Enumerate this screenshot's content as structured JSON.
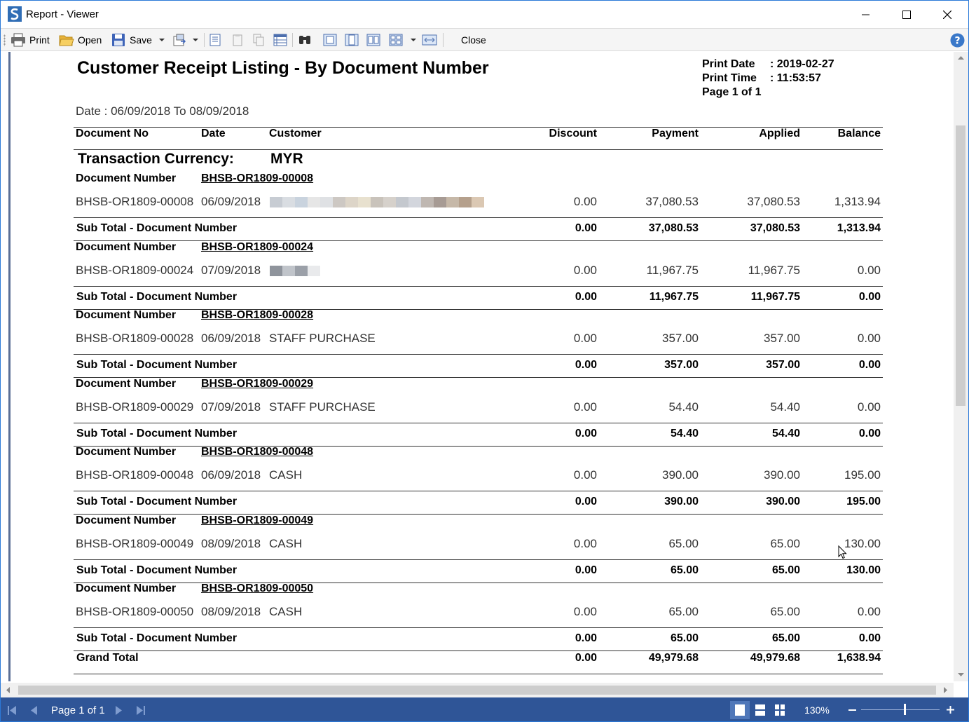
{
  "window": {
    "title": "Report - Viewer"
  },
  "toolbar": {
    "print_label": "Print",
    "open_label": "Open",
    "save_label": "Save",
    "close_label": "Close"
  },
  "report": {
    "title": "Customer Receipt Listing - By Document Number",
    "print_date_label": "Print Date",
    "print_date": ": 2019-02-27",
    "print_time_label": "Print Time",
    "print_time": ": 11:53:57",
    "page_info": "Page 1 of 1",
    "date_range": "Date : 06/09/2018 To 08/09/2018",
    "columns": {
      "document_no": "Document No",
      "date": "Date",
      "customer": "Customer",
      "discount": "Discount",
      "payment": "Payment",
      "applied": "Applied",
      "balance": "Balance"
    },
    "currency_label": "Transaction Currency:",
    "currency": "MYR",
    "group_label": "Document Number",
    "subtotal_label": "Sub Total - Document Number",
    "groups": [
      {
        "doc": "BHSB-OR1809-00008",
        "row": {
          "doc": "BHSB-OR1809-00008",
          "date": "06/09/2018",
          "customer": "",
          "discount": "0.00",
          "payment": "37,080.53",
          "applied": "37,080.53",
          "balance": "1,313.94"
        },
        "subtotal": {
          "discount": "0.00",
          "payment": "37,080.53",
          "applied": "37,080.53",
          "balance": "1,313.94"
        }
      },
      {
        "doc": "BHSB-OR1809-00024",
        "row": {
          "doc": "BHSB-OR1809-00024",
          "date": "07/09/2018",
          "customer": "",
          "discount": "0.00",
          "payment": "11,967.75",
          "applied": "11,967.75",
          "balance": "0.00"
        },
        "subtotal": {
          "discount": "0.00",
          "payment": "11,967.75",
          "applied": "11,967.75",
          "balance": "0.00"
        }
      },
      {
        "doc": "BHSB-OR1809-00028",
        "row": {
          "doc": "BHSB-OR1809-00028",
          "date": "06/09/2018",
          "customer": "STAFF PURCHASE",
          "discount": "0.00",
          "payment": "357.00",
          "applied": "357.00",
          "balance": "0.00"
        },
        "subtotal": {
          "discount": "0.00",
          "payment": "357.00",
          "applied": "357.00",
          "balance": "0.00"
        }
      },
      {
        "doc": "BHSB-OR1809-00029",
        "row": {
          "doc": "BHSB-OR1809-00029",
          "date": "07/09/2018",
          "customer": "STAFF PURCHASE",
          "discount": "0.00",
          "payment": "54.40",
          "applied": "54.40",
          "balance": "0.00"
        },
        "subtotal": {
          "discount": "0.00",
          "payment": "54.40",
          "applied": "54.40",
          "balance": "0.00"
        }
      },
      {
        "doc": "BHSB-OR1809-00048",
        "row": {
          "doc": "BHSB-OR1809-00048",
          "date": "06/09/2018",
          "customer": "CASH",
          "discount": "0.00",
          "payment": "390.00",
          "applied": "390.00",
          "balance": "195.00"
        },
        "subtotal": {
          "discount": "0.00",
          "payment": "390.00",
          "applied": "390.00",
          "balance": "195.00"
        }
      },
      {
        "doc": "BHSB-OR1809-00049",
        "row": {
          "doc": "BHSB-OR1809-00049",
          "date": "08/09/2018",
          "customer": "CASH",
          "discount": "0.00",
          "payment": "65.00",
          "applied": "65.00",
          "balance": "130.00"
        },
        "subtotal": {
          "discount": "0.00",
          "payment": "65.00",
          "applied": "65.00",
          "balance": "130.00"
        }
      },
      {
        "doc": "BHSB-OR1809-00050",
        "row": {
          "doc": "BHSB-OR1809-00050",
          "date": "08/09/2018",
          "customer": "CASH",
          "discount": "0.00",
          "payment": "65.00",
          "applied": "65.00",
          "balance": "0.00"
        },
        "subtotal": {
          "discount": "0.00",
          "payment": "65.00",
          "applied": "65.00",
          "balance": "0.00"
        }
      }
    ],
    "grand_total_label": "Grand Total",
    "grand_total": {
      "discount": "0.00",
      "payment": "49,979.68",
      "applied": "49,979.68",
      "balance": "1,638.94"
    }
  },
  "status": {
    "page_label": "Page 1 of 1",
    "zoom": "130%"
  },
  "colors": {
    "statusbar": "#2f5597",
    "window_border": "#2b79d8"
  }
}
